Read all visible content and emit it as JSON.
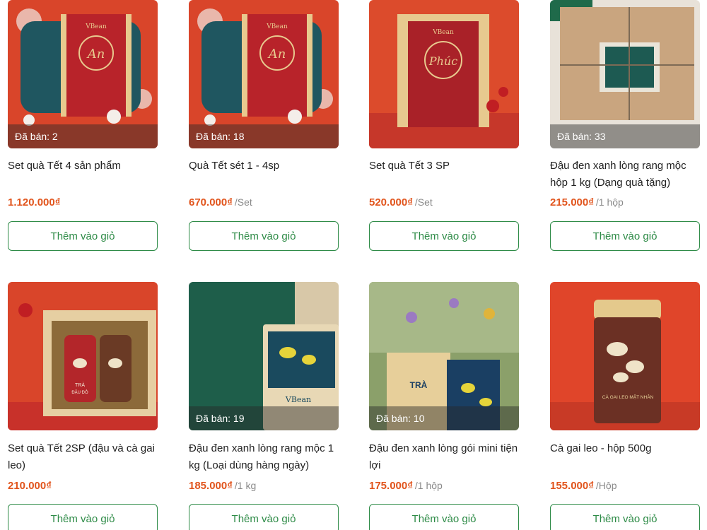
{
  "products": [
    {
      "sold": "Đã bán: 2",
      "name": "Set quà Tết 4 sản phẩm",
      "price": "1.120.000₫",
      "unit": "",
      "button": "Thêm vào giỏ",
      "image": "red-basket-an"
    },
    {
      "sold": "Đã bán: 18",
      "name": "Quà Tết sét 1 - 4sp",
      "price": "670.000₫",
      "unit": "/Set",
      "button": "Thêm vào giỏ",
      "image": "red-basket-an"
    },
    {
      "sold": "",
      "name": "Set quà Tết 3 SP",
      "price": "520.000₫",
      "unit": "/Set",
      "button": "Thêm vào giỏ",
      "image": "bamboo-box-phuc"
    },
    {
      "sold": "Đã bán: 33",
      "name": "Đậu đen xanh lòng rang mộc hộp 1 kg (Dạng quà tặng)",
      "price": "215.000₫",
      "unit": "/1 hộp",
      "button": "Thêm vào giỏ",
      "image": "kraft-gift-box"
    },
    {
      "sold": "",
      "name": "Set quà Tết 2SP (đậu và cà gai leo)",
      "price": "210.000₫",
      "unit": "",
      "button": "Thêm vào giỏ",
      "image": "wooden-tray-jars"
    },
    {
      "sold": "Đã bán: 19",
      "name": "Đậu đen xanh lòng rang mộc 1 kg (Loại dùng hàng ngày)",
      "price": "185.000₫",
      "unit": "/1 kg",
      "button": "Thêm vào giỏ",
      "image": "green-pouch"
    },
    {
      "sold": "Đã bán: 10",
      "name": "Đậu đen xanh lòng gói mini tiện lợi",
      "price": "175.000₫",
      "unit": "/1 hộp",
      "button": "Thêm vào giỏ",
      "image": "tea-box-flowers"
    },
    {
      "sold": "",
      "name": "Cà gai leo - hộp 500g",
      "price": "155.000₫",
      "unit": "/Hộp",
      "button": "Thêm vào giỏ",
      "image": "paper-jar"
    }
  ],
  "brand_text": {
    "vbean": "VBean",
    "an": "An",
    "phuc": "Phúc",
    "tra": "TRÀ",
    "dau_do": "ĐẬU ĐỎ",
    "ca_gai_leo": "CÀ GAI LEO MẬT NHÂN"
  },
  "colors": {
    "price": "#e1541c",
    "button": "#2e8b47",
    "backdrop_red": "#e0452a"
  }
}
